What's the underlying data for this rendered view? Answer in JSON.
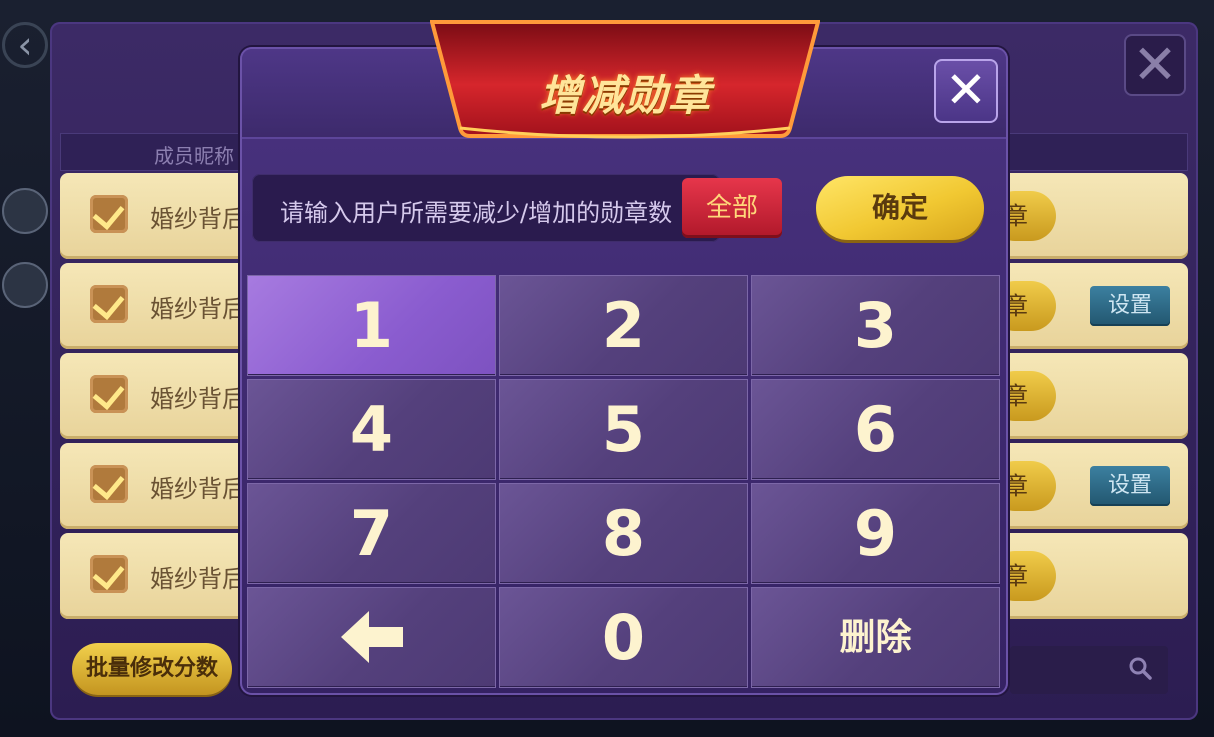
{
  "background": {
    "column_header": "成员昵称",
    "rows": [
      {
        "name": "婚纱背后",
        "checked": true,
        "badge_label": "章",
        "set_label": ""
      },
      {
        "name": "婚纱背后",
        "checked": true,
        "badge_label": "章",
        "set_label": "设置"
      },
      {
        "name": "婚纱背后",
        "checked": true,
        "badge_label": "章",
        "set_label": ""
      },
      {
        "name": "婚纱背后",
        "checked": true,
        "badge_label": "章",
        "set_label": "设置"
      },
      {
        "name": "婚纱背后",
        "checked": true,
        "badge_label": "章",
        "set_label": ""
      }
    ],
    "batch_button": "批量修改分数",
    "close_icon": "close-icon",
    "back_icon": "back-arrow-icon",
    "search_icon": "search-icon"
  },
  "modal": {
    "title": "增减勋章",
    "input_placeholder": "请输入用户所需要减少/增加的勋章数",
    "all_button": "全部",
    "confirm_button": "确定",
    "close_icon": "close-icon",
    "keypad": {
      "k1": "1",
      "k2": "2",
      "k3": "3",
      "k4": "4",
      "k5": "5",
      "k6": "6",
      "k7": "7",
      "k8": "8",
      "k9": "9",
      "backspace_icon": "left-arrow-icon",
      "k0": "0",
      "delete": "删除"
    },
    "highlighted_key": "1"
  },
  "colors": {
    "modal_bg": "#4a3380",
    "key_active": "#9a6bd9",
    "ribbon_red": "#d0282c",
    "gold_button": "#f1c832",
    "row_bg": "#f5e7b7"
  }
}
